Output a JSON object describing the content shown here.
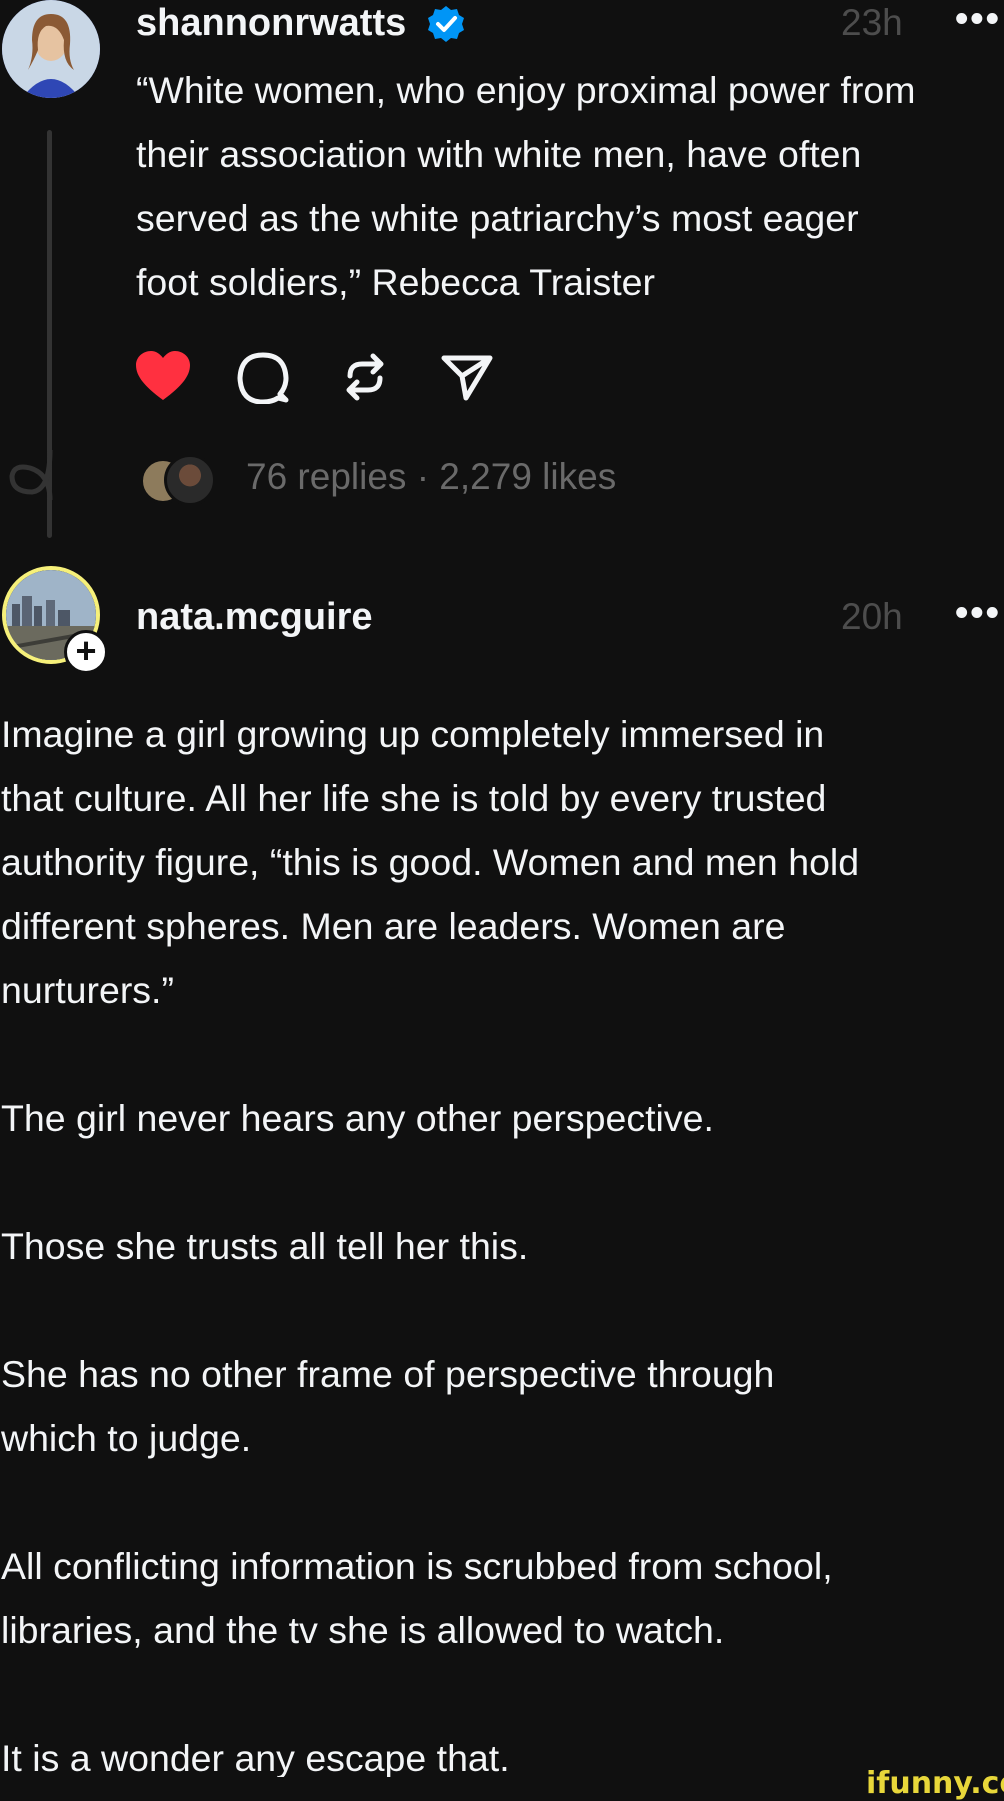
{
  "post1": {
    "username": "shannonrwatts",
    "verified": true,
    "time": "23h",
    "text_lines": [
      "“White women, who enjoy proximal power from",
      "their association with white men, have often",
      "served as the white patriarchy’s most eager",
      "foot soldiers,” Rebecca Traister"
    ],
    "liked": true,
    "stats": "76 replies · 2,279 likes",
    "actions": [
      "heart-icon",
      "comment-icon",
      "repost-icon",
      "share-icon"
    ]
  },
  "post2": {
    "username": "nata.mcguire",
    "time": "20h",
    "follow_symbol": "+",
    "paragraphs": [
      [
        "Imagine a girl growing up completely immersed in",
        "that culture. All her life she is told by every trusted",
        "authority figure, “this is good. Women and men hold",
        "different spheres. Men are leaders. Women are",
        "nurturers.”"
      ],
      [
        "The girl never hears any other perspective."
      ],
      [
        "Those she trusts all tell her this."
      ],
      [
        "She has no other frame of perspective through",
        "which to judge."
      ],
      [
        "All conflicting information is scrubbed from school,",
        "libraries, and the tv she is allowed to watch."
      ],
      [
        "It is a wonder any escape that."
      ]
    ]
  },
  "more_symbol": "•••",
  "watermark": "ifunny.co",
  "colors": {
    "background": "#101010",
    "text": "#f3f5f7",
    "muted": "#6a6a6a",
    "verified": "#0095f6",
    "heart": "#ff3040",
    "watermark": "#e8d73a"
  }
}
